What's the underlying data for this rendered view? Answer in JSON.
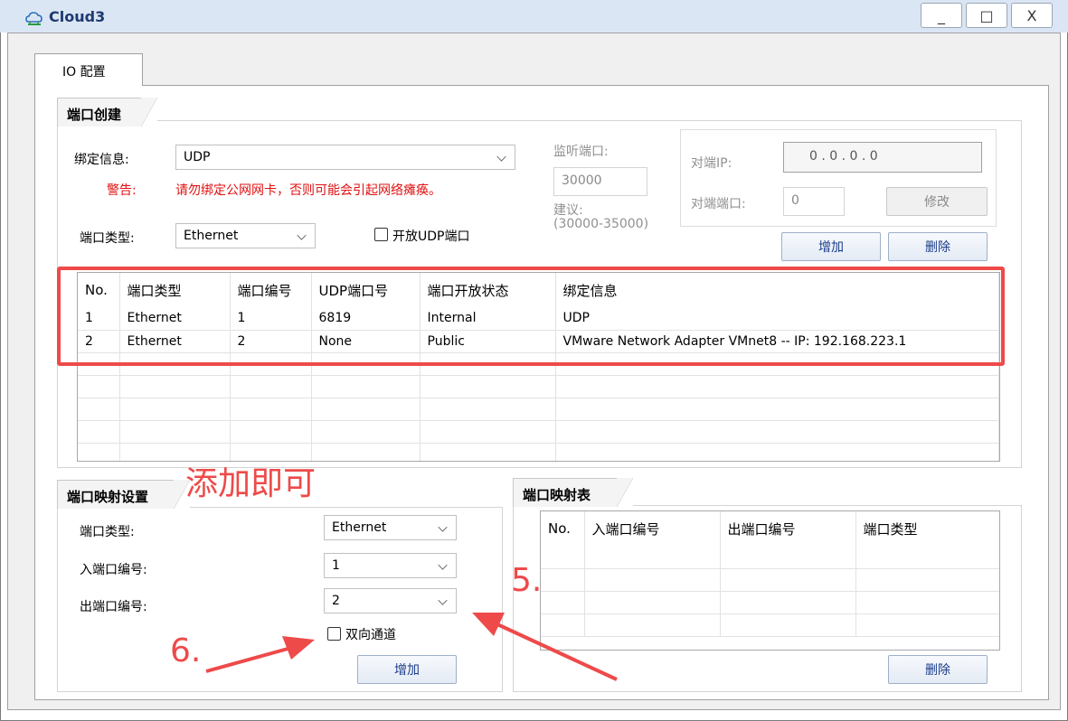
{
  "window": {
    "title": "Cloud3",
    "minimize": "_",
    "maximize": "□",
    "close": "X"
  },
  "tab": {
    "label": "IO 配置"
  },
  "port_create": {
    "header": "端口创建",
    "bind_label": "绑定信息:",
    "bind_value": "UDP",
    "warning_label": "警告:",
    "warning_text": "请勿绑定公网网卡，否则可能会引起网络瘫痪。",
    "port_type_label": "端口类型:",
    "port_type_value": "Ethernet",
    "open_udp_label": "开放UDP端口",
    "open_udp_checked": false,
    "listen_port_label": "监听端口:",
    "listen_port_value": "30000",
    "suggest_label": "建议:",
    "suggest_range": "(30000-35000)",
    "peer_ip_label": "对端IP:",
    "peer_ip_value": "0  .  0  .  0  .  0",
    "peer_port_label": "对端端口:",
    "peer_port_value": "0",
    "modify_button": "修改",
    "add_button": "增加",
    "delete_button": "删除"
  },
  "port_table": {
    "columns": [
      "No.",
      "端口类型",
      "端口编号",
      "UDP端口号",
      "端口开放状态",
      "绑定信息"
    ],
    "rows": [
      [
        "1",
        "Ethernet",
        "1",
        "6819",
        "Internal",
        "UDP"
      ],
      [
        "2",
        "Ethernet",
        "2",
        "None",
        "Public",
        "VMware Network Adapter VMnet8 -- IP: 192.168.223.1"
      ]
    ]
  },
  "mapping_settings": {
    "header": "端口映射设置",
    "port_type_label": "端口类型:",
    "port_type_value": "Ethernet",
    "in_port_label": "入端口编号:",
    "in_port_value": "1",
    "out_port_label": "出端口编号:",
    "out_port_value": "2",
    "bidirectional_label": "双向通道",
    "bidirectional_checked": false,
    "add_button": "增加"
  },
  "mapping_table": {
    "header": "端口映射表",
    "columns": [
      "No.",
      "入端口编号",
      "出端口编号",
      "端口类型"
    ],
    "delete_button": "删除"
  },
  "annotations": {
    "note": "添加即可",
    "step5": "5.",
    "step6": "6.",
    "color": "#ee4a4a"
  }
}
